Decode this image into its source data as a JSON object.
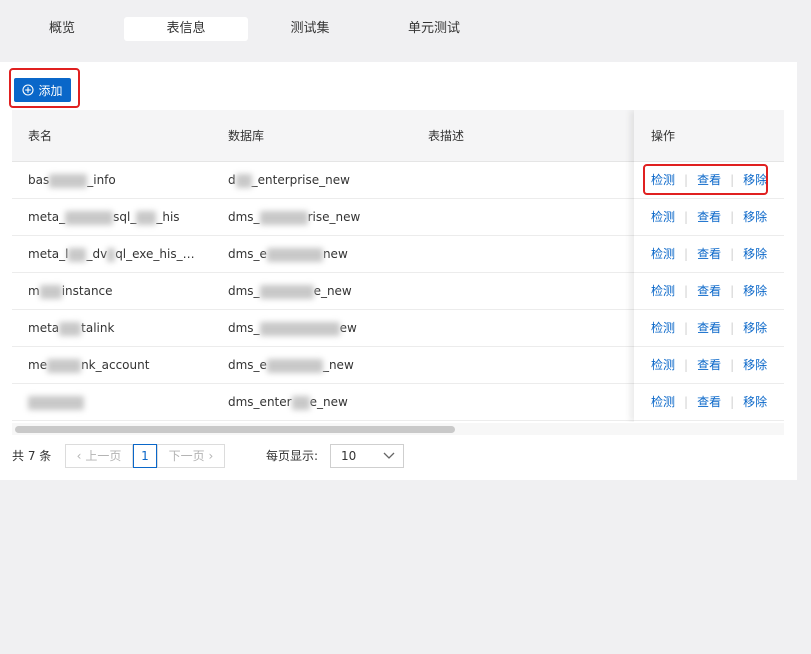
{
  "tabs": [
    {
      "label": "概览"
    },
    {
      "label": "表信息",
      "active": true
    },
    {
      "label": "测试集"
    },
    {
      "label": "单元测试"
    }
  ],
  "toolbar": {
    "add_label": "添加",
    "add_icon": "plus-circle-icon"
  },
  "table": {
    "headers": {
      "name": "表名",
      "database": "数据库",
      "description": "表描述",
      "ops": "操作"
    },
    "rows": [
      {
        "name": [
          "bas",
          "_info"
        ],
        "database": [
          "d",
          "_enterprise_new"
        ]
      },
      {
        "name": [
          "meta_",
          "sql_",
          "_his"
        ],
        "database": [
          "dms_",
          "rise_new"
        ]
      },
      {
        "name": [
          "meta_l",
          "_dv",
          "ql_exe_his_…"
        ],
        "database": [
          "dms_e",
          "new"
        ]
      },
      {
        "name": [
          "m",
          "instance"
        ],
        "database": [
          "dms_",
          "e_new"
        ]
      },
      {
        "name": [
          "meta",
          "talink"
        ],
        "database": [
          "dms_",
          "ew"
        ]
      },
      {
        "name": [
          "me",
          "nk_account"
        ],
        "database": [
          "dms_e",
          "_new"
        ]
      },
      {
        "name": [
          "",
          ""
        ],
        "database": [
          "dms_enter",
          "e_new"
        ]
      }
    ],
    "ops": {
      "check": "检测",
      "view": "查看",
      "remove": "移除",
      "sep": "|"
    }
  },
  "pagination": {
    "total": "共 7 条",
    "prev": "上一页",
    "next": "下一页",
    "page": "1",
    "per_page_label": "每页显示:",
    "per_page_value": "10"
  },
  "colors": {
    "accent": "#0a67c9",
    "highlight": "#e02020"
  }
}
